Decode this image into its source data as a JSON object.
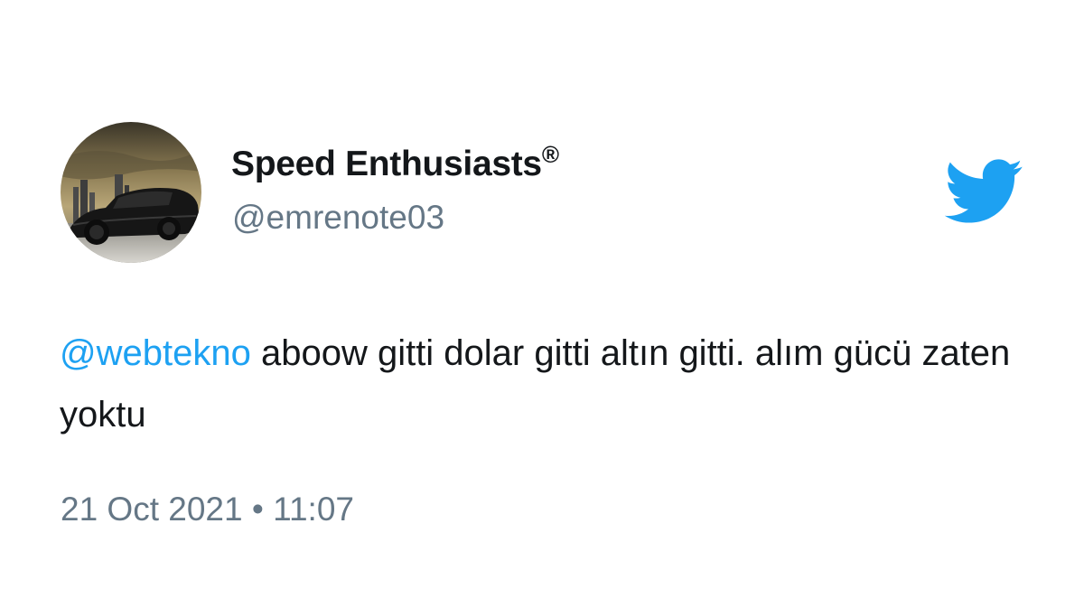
{
  "tweet": {
    "author": {
      "display_name": "Speed Enthusiasts",
      "registered_mark": "®",
      "handle": "@emrenote03",
      "avatar": "dark-sports-car-avatar"
    },
    "platform_icon": "twitter-bird-icon",
    "brand_color": "#1da1f2",
    "body": {
      "mention": "@webtekno",
      "text": " aboow gitti dolar gitti altın gitti. alım gücü zaten yoktu"
    },
    "date": "21 Oct 2021",
    "separator": "•",
    "time": "11:07"
  }
}
